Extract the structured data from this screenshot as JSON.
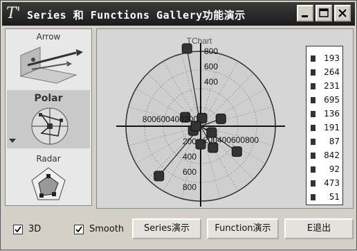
{
  "window": {
    "title": "Series 和 Functions Gallery功能演示",
    "icon": "tee-chart-logo-icon"
  },
  "titlebar_buttons": [
    "minimize-icon",
    "maximize-icon",
    "close-icon"
  ],
  "gallery": {
    "items": [
      {
        "label": "Arrow",
        "selected": false
      },
      {
        "label": "Polar",
        "selected": true
      },
      {
        "label": "Radar",
        "selected": false
      }
    ]
  },
  "chart": {
    "title": "TChart",
    "legend": [
      "193",
      "264",
      "231",
      "695",
      "136",
      "191",
      "87",
      "842",
      "92",
      "473",
      "51"
    ]
  },
  "chart_data": {
    "type": "polar",
    "title": "TChart",
    "radial_ticks": [
      "200",
      "400",
      "600",
      "800"
    ],
    "radial_tick_text_up": [
      "800",
      "600",
      "400"
    ],
    "radial_tick_text_down": [
      "200",
      "400",
      "600",
      "800"
    ],
    "radial_tick_text_left": "800600400200",
    "radial_tick_text_right": "200400600800",
    "rmax": 800,
    "values": [
      193,
      264,
      231,
      695,
      136,
      191,
      87,
      842,
      92,
      473,
      51
    ],
    "angles_deg": [
      270,
      300,
      20,
      230,
      330,
      150,
      80,
      100,
      210,
      325,
      180
    ],
    "grid": true
  },
  "controls": {
    "check_3d": {
      "label": "3D",
      "checked": true
    },
    "check_smooth": {
      "label": "Smooth",
      "checked": true
    },
    "series_button": "Series演示",
    "function_button": "Function演示",
    "exit_button": "E退出"
  }
}
